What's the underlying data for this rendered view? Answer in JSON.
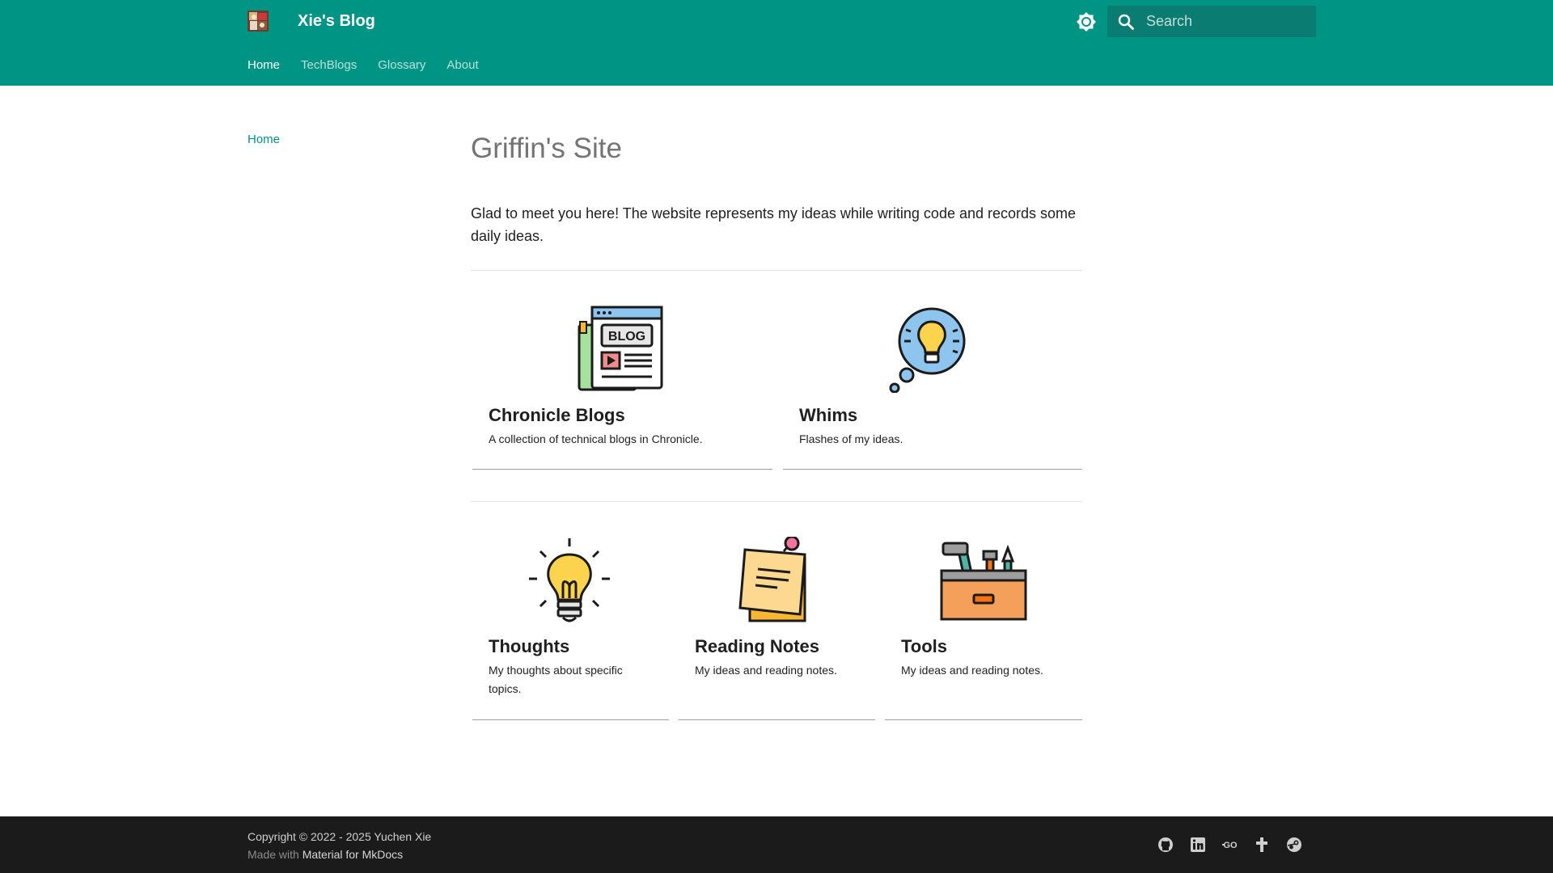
{
  "header": {
    "site_title": "Xie's Blog",
    "search_placeholder": "Search",
    "tabs": [
      {
        "label": "Home",
        "active": true
      },
      {
        "label": "TechBlogs",
        "active": false
      },
      {
        "label": "Glossary",
        "active": false
      },
      {
        "label": "About",
        "active": false
      }
    ],
    "icons": [
      "site-logo",
      "brightness-icon",
      "search-icon"
    ]
  },
  "sidebar": {
    "items": [
      {
        "label": "Home"
      }
    ]
  },
  "main": {
    "title": "Griffin's Site",
    "intro": "Glad to meet you here! The website represents my ideas while writing code and records some daily ideas.",
    "cards": [
      {
        "title": "Chronicle Blogs",
        "description": "A collection of technical blogs in Chronicle.",
        "icon": "blog-icon"
      },
      {
        "title": "Whims",
        "description": "Flashes of my ideas.",
        "icon": "thought-bubble-icon"
      },
      {
        "title": "Thoughts",
        "description": "My thoughts about specific topics.",
        "icon": "lightbulb-icon"
      },
      {
        "title": "Reading Notes",
        "description": "My ideas and reading notes.",
        "icon": "sticky-note-icon"
      },
      {
        "title": "Tools",
        "description": "My ideas and reading notes.",
        "icon": "toolbox-icon"
      }
    ]
  },
  "footer": {
    "copyright": "Copyright © 2022 - 2025 Yuchen Xie",
    "made_with_prefix": "Made with",
    "made_with_link": "Material for MkDocs",
    "social_icons": [
      "github-icon",
      "linkedin-icon",
      "goodreads-icon",
      "blog-link-icon",
      "steam-icon"
    ]
  },
  "colors": {
    "primary": "#009485",
    "accent_link": "#009485",
    "footer_bg": "#1b1b1b",
    "title_gray": "#747474"
  }
}
